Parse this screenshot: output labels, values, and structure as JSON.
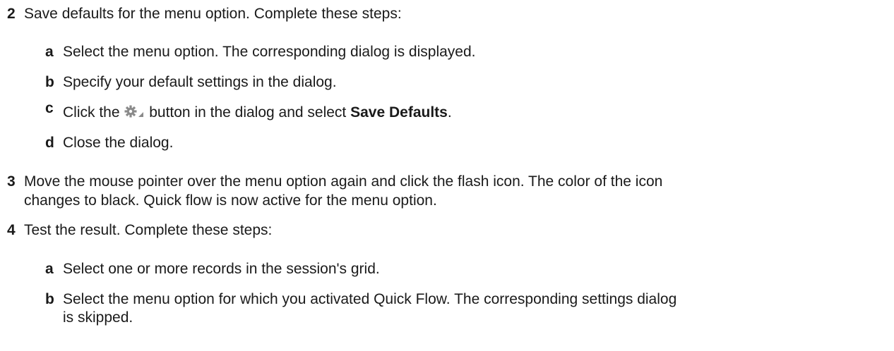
{
  "steps": [
    {
      "number": "2",
      "text": "Save defaults for the menu option. Complete these steps:",
      "substeps": [
        {
          "letter": "a",
          "text": "Select the menu option. The corresponding dialog is displayed."
        },
        {
          "letter": "b",
          "text": "Specify your default settings in the dialog."
        },
        {
          "letter": "c",
          "text_before": "Click the",
          "icon": "gear-dropdown-icon",
          "text_middle": "button in the dialog and select",
          "bold": "Save Defaults",
          "text_after": "."
        },
        {
          "letter": "d",
          "text": "Close the dialog."
        }
      ]
    },
    {
      "number": "3",
      "line1": "Move the mouse pointer over the menu option again and click the flash icon. The color of the icon",
      "line2": "changes to black. Quick flow is now active for the menu option."
    },
    {
      "number": "4",
      "text": "Test the result. Complete these steps:",
      "substeps": [
        {
          "letter": "a",
          "text": "Select one or more records in the session's grid."
        },
        {
          "letter": "b",
          "line1": "Select the menu option for which you activated Quick Flow. The corresponding settings dialog",
          "line2": "is skipped."
        }
      ]
    }
  ]
}
